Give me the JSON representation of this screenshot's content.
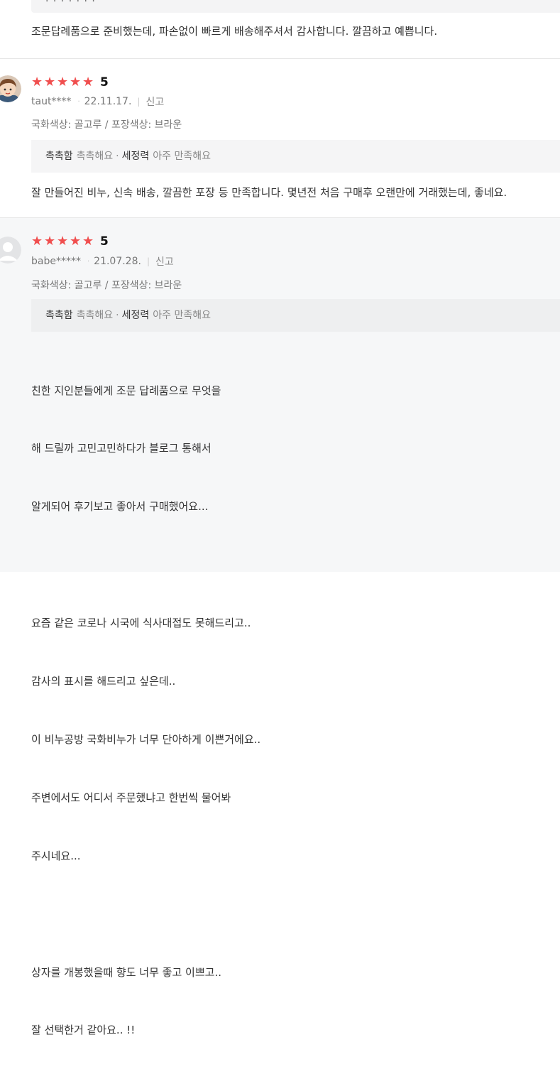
{
  "reviews": [
    {
      "top_fragment": "· · ·  · · · ·",
      "body": "조문답례품으로 준비했는데, 파손없이 빠르게 배송해주셔서 감사합니다. 깔끔하고 예쁩니다."
    },
    {
      "avatar": "boy-avatar",
      "stars_icon": "★★★★★",
      "score": "5",
      "user": "taut****",
      "date": "22.11.17.",
      "report": "신고",
      "option": "국화색상: 골고루 / 포장색상: 브라운",
      "eval": [
        {
          "key": "촉촉함",
          "value": "촉촉해요"
        },
        {
          "key": "세정력",
          "value": "아주 만족해요"
        }
      ],
      "eval_sep": "·",
      "body": "잘 만들어진 비누, 신속 배송, 깔끔한 포장 등 만족합니다. 몇년전 처음 구매후 오랜만에 거래했는데, 좋네요."
    },
    {
      "avatar": "default-user-avatar",
      "stars_icon": "★★★★★",
      "score": "5",
      "user": "babe*****",
      "date": "21.07.28.",
      "report": "신고",
      "option": "국화색상: 골고루 / 포장색상: 브라운",
      "eval": [
        {
          "key": "촉촉함",
          "value": "촉촉해요"
        },
        {
          "key": "세정력",
          "value": "아주 만족해요"
        }
      ],
      "eval_sep": "·",
      "body_lines": [
        "친한 지인분들에게 조문 답례품으로 무엇을",
        "해 드릴까 고민고민하다가 블로그 통해서",
        "알게되어 후기보고 좋아서 구매했어요...",
        "",
        "요즘 같은 코로나 시국에 식사대접도 못해드리고..",
        "감사의 표시를 해드리고 싶은데..",
        "이 비누공방 국화비누가 너무 단아하게 이쁜거에요..",
        "주변에서도 어디서 주문했냐고 한번씩 물어봐",
        "주시네요...",
        "",
        "상자를 개봉했을때 향도 너무 좋고 이쁘고..",
        "잘 선택한거 같아요.. !!"
      ]
    }
  ],
  "colors": {
    "star": "#f04e4e",
    "eval_bg": "#f5f5f6",
    "selected_review_bg": "#f6f7f8"
  }
}
